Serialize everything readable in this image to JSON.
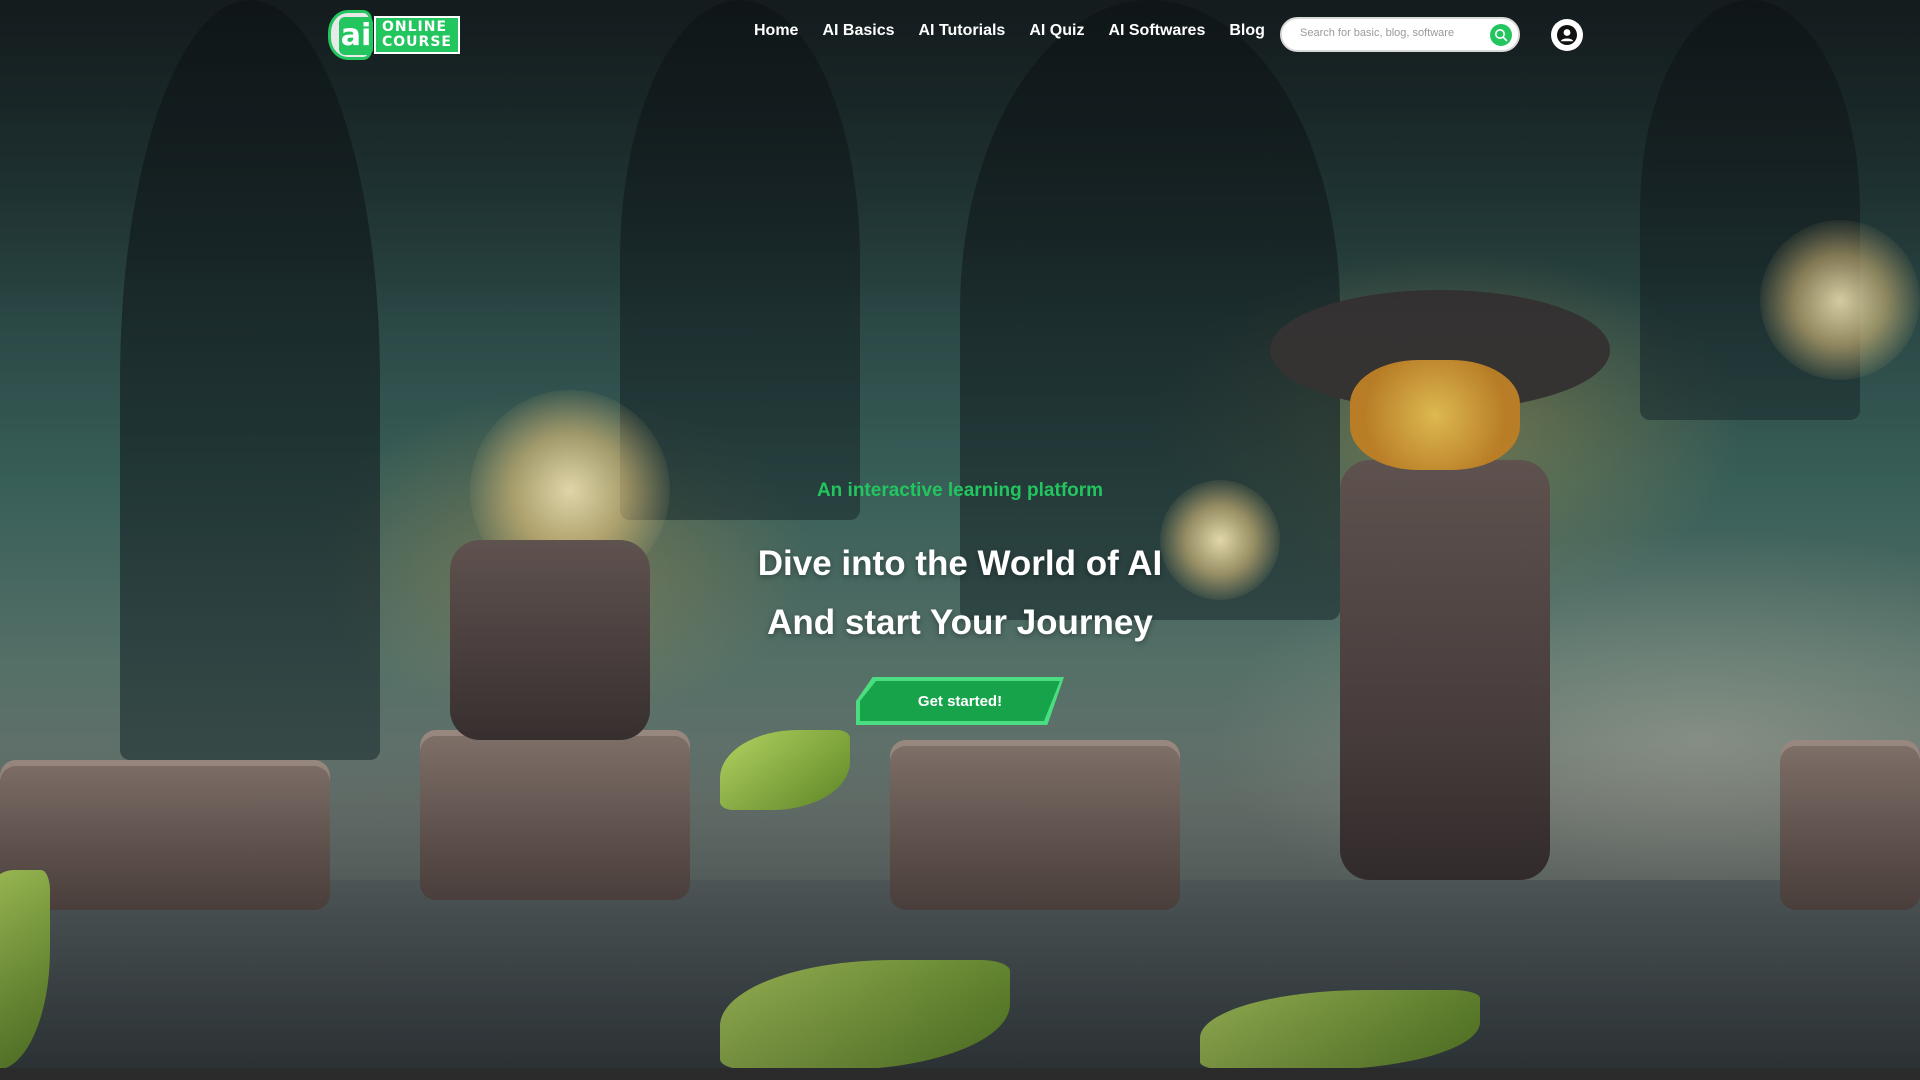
{
  "logo": {
    "text_top": "ONLINE",
    "text_bottom": "COURSE",
    "badge": "ai"
  },
  "nav": {
    "items": [
      {
        "label": "Home"
      },
      {
        "label": "AI Basics"
      },
      {
        "label": "AI Tutorials"
      },
      {
        "label": "AI Quiz"
      },
      {
        "label": "AI Softwares"
      },
      {
        "label": "Blog"
      }
    ]
  },
  "search": {
    "placeholder": "Search for basic, blog, software",
    "icon": "search-icon"
  },
  "account": {
    "icon": "user-icon"
  },
  "hero": {
    "tagline": "An interactive learning platform",
    "headline_line1": "Dive into the World of AI",
    "headline_line2": "And start Your Journey",
    "cta_label": "Get started!"
  },
  "colors": {
    "accent": "#22c55e",
    "cta": "#16a34a",
    "text": "#ffffff"
  }
}
